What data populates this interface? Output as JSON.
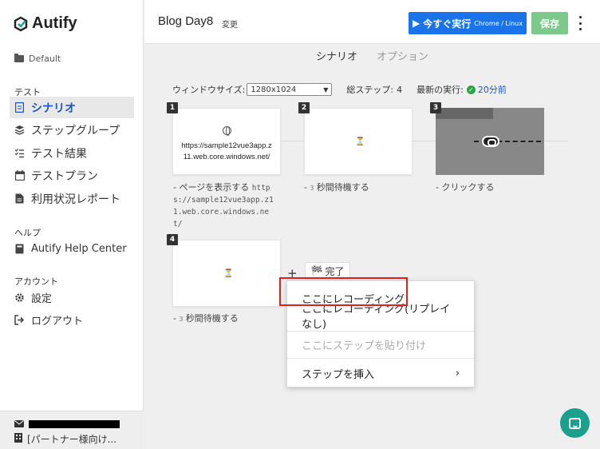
{
  "sidebar": {
    "logo": "Autify",
    "workspace": "Default",
    "sections": {
      "test": "テスト",
      "help": "ヘルプ",
      "account": "アカウント"
    },
    "items": [
      {
        "label": "シナリオ",
        "icon": "document-icon",
        "active": true
      },
      {
        "label": "ステップグループ",
        "icon": "layers-icon"
      },
      {
        "label": "テスト結果",
        "icon": "checklist-icon"
      },
      {
        "label": "テストプラン",
        "icon": "calendar-icon"
      },
      {
        "label": "利用状況レポート",
        "icon": "report-icon"
      }
    ],
    "help_items": [
      {
        "label": "Autify Help Center",
        "icon": "book-icon"
      }
    ],
    "account_items": [
      {
        "label": "設定",
        "icon": "gear-icon"
      },
      {
        "label": "ログアウト",
        "icon": "logout-icon"
      }
    ],
    "footer": {
      "org": "[パートナー様向け..."
    }
  },
  "header": {
    "title": "Blog Day8",
    "rename": "変更",
    "run_label": "今すぐ実行",
    "run_sub": "Chrome / Linux",
    "save_label": "保存"
  },
  "tabs": [
    "シナリオ",
    "オプション"
  ],
  "toolbar": {
    "window_size_label": "ウィンドウサイズ:",
    "window_size_value": "1280x1024",
    "total_steps_label": "総ステップ:",
    "total_steps": "4",
    "last_run_label": "最新の実行:",
    "last_run_value": "20分前"
  },
  "steps": [
    {
      "num": "1",
      "url": "https://sample12vue3app.z11.web.core.windows.net/",
      "caption_prefix": "- ページを表示する",
      "caption_code": "https://sample12vue3app.z11.web.core.windows.net/"
    },
    {
      "num": "2",
      "caption_prefix": "-",
      "caption_code": "3",
      "caption_suffix": "秒間待機する"
    },
    {
      "num": "3",
      "caption_prefix": "- クリックする"
    },
    {
      "num": "4",
      "caption_prefix": "-",
      "caption_code": "3",
      "caption_suffix": "秒間待機する"
    }
  ],
  "done_label": "完了",
  "context_menu": {
    "record_here": "ここにレコーディング",
    "record_here_no_replay": "ここにレコーディング(リプレイなし)",
    "paste_step": "ここにステップを貼り付け",
    "insert_step": "ステップを挿入"
  },
  "colors": {
    "primary": "#1a73e8",
    "save": "#7cc98b",
    "highlight": "#e02020",
    "chat": "#1aa08c"
  }
}
